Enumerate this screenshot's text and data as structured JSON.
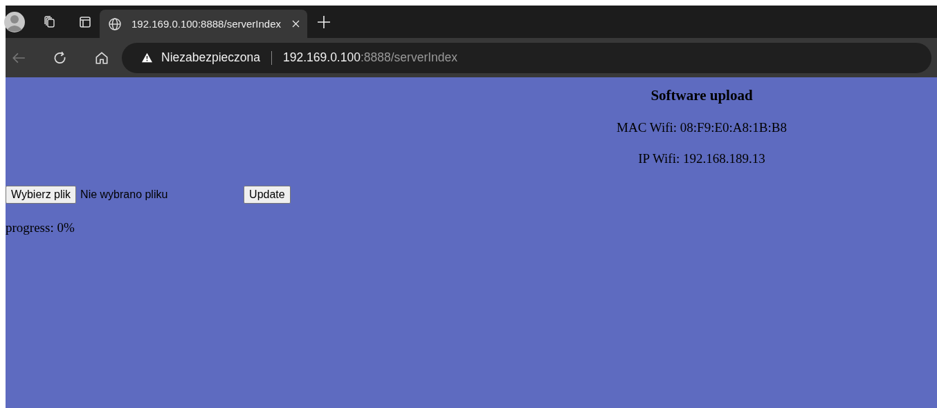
{
  "tab": {
    "title": "192.169.0.100:8888/serverIndex",
    "selected": true
  },
  "address_bar": {
    "security_label": "Niezabezpieczona",
    "host": "192.169.0.100",
    "path": ":8888/serverIndex"
  },
  "page": {
    "heading": "Software upload",
    "mac_wifi": "MAC Wifi: 08:F9:E0:A8:1B:B8",
    "ip_wifi": "IP Wifi: 192.168.189.13",
    "file_button": "Wybierz plik",
    "file_status": "Nie wybrano pliku",
    "update_button": "Update",
    "progress": "progress: 0%"
  }
}
